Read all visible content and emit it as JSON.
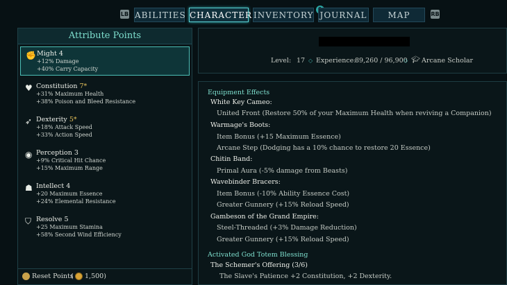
{
  "nav": {
    "left_key": "LB",
    "right_key": "RB",
    "tabs": [
      "ABILITIES",
      "CHARACTER",
      "INVENTORY",
      "JOURNAL",
      "MAP"
    ],
    "active_tab": "CHARACTER",
    "journal_notification": "1"
  },
  "attributes": {
    "title": "Attribute Points",
    "items": [
      {
        "name": "Might",
        "value": "4",
        "bonus1": "+12% Damage",
        "bonus2": "+40% Carry Capacity",
        "icon": "fist-icon",
        "selected": true
      },
      {
        "name": "Constitution",
        "value": "7*",
        "bonus1": "+31% Maximum Health",
        "bonus2": "+38% Poison and Bleed Resistance",
        "icon": "heart-icon"
      },
      {
        "name": "Dexterity",
        "value": "5*",
        "bonus1": "+18% Attack Speed",
        "bonus2": "+33% Action Speed",
        "icon": "running-icon"
      },
      {
        "name": "Perception",
        "value": "3",
        "bonus1": "+9% Critical Hit Chance",
        "bonus2": "+15% Maximum Range",
        "icon": "eye-icon"
      },
      {
        "name": "Intellect",
        "value": "4",
        "bonus1": "+20 Maximum Essence",
        "bonus2": "+24% Elemental Resistance",
        "icon": "head-icon"
      },
      {
        "name": "Resolve",
        "value": "5",
        "bonus1": "+25 Maximum Stamina",
        "bonus2": "+58% Second Wind Efficiency",
        "icon": "shield-icon"
      }
    ],
    "reset_label": "Reset Points",
    "reset_cost": "1,500"
  },
  "character": {
    "level_label": "Level:",
    "level": "17",
    "experience_label": "Experience:",
    "experience": "89,260 / 96,900",
    "class_name": "Arcane Scholar"
  },
  "details": {
    "equipment_header": "Equipment Effects",
    "lines": [
      {
        "kind": "item",
        "text": "White Key Cameo:"
      },
      {
        "kind": "eff",
        "text": "United Front  (Restore 50% of your Maximum Health when reviving a Companion)"
      },
      {
        "kind": "item",
        "text": "Warmage's Boots:"
      },
      {
        "kind": "eff",
        "text": "Item Bonus  (+15 Maximum Essence)"
      },
      {
        "kind": "eff",
        "text": "Arcane Step  (Dodging has a 10% chance to restore 20 Essence)"
      },
      {
        "kind": "item",
        "text": "Chitin Band:"
      },
      {
        "kind": "eff",
        "text": "Primal Aura  (-5% damage from Beasts)"
      },
      {
        "kind": "item",
        "text": "Wavebinder Bracers:"
      },
      {
        "kind": "eff",
        "text": "Item Bonus  (-10% Ability Essence Cost)"
      },
      {
        "kind": "eff",
        "text": "Greater Gunnery  (+15% Reload Speed)"
      },
      {
        "kind": "item",
        "text": "Gambeson of the Grand Empire:"
      },
      {
        "kind": "eff",
        "text": "Steel-Threaded  (+3% Damage Reduction)"
      },
      {
        "kind": "eff",
        "text": "Greater Gunnery  (+15% Reload Speed)"
      }
    ],
    "blessing_header": "Activated God Totem Blessing",
    "blessing_name": "The Schemer's Offering (3/6)",
    "blessing_effect": "The Slave's Patience  +2 Constitution, +2 Dexterity."
  }
}
